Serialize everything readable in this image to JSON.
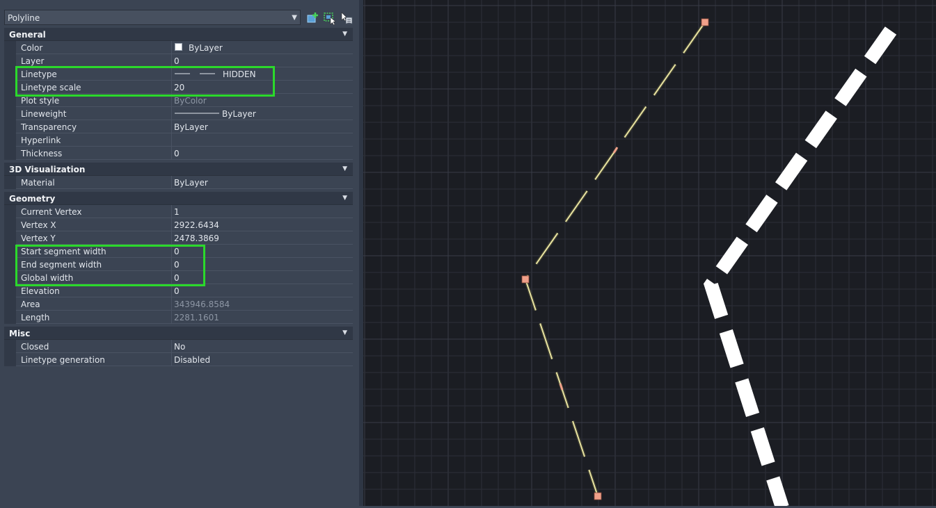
{
  "panel": {
    "object_selector": "Polyline",
    "toolbar_icons": [
      "quick-select-icon",
      "select-objects-icon",
      "toggle-pickadd-icon"
    ]
  },
  "sections": [
    {
      "title": "General",
      "rows": [
        {
          "label": "Color",
          "value": "ByLayer",
          "swatch": "#ffffff"
        },
        {
          "label": "Layer",
          "value": "0"
        },
        {
          "label": "Linetype",
          "value": "HIDDEN",
          "preview": "dashes"
        },
        {
          "label": "Linetype scale",
          "value": "20"
        },
        {
          "label": "Plot style",
          "value": "ByColor",
          "dim": true
        },
        {
          "label": "Lineweight",
          "value": "ByLayer",
          "preview": "solid"
        },
        {
          "label": "Transparency",
          "value": "ByLayer"
        },
        {
          "label": "Hyperlink",
          "value": ""
        },
        {
          "label": "Thickness",
          "value": "0"
        }
      ]
    },
    {
      "title": "3D Visualization",
      "rows": [
        {
          "label": "Material",
          "value": "ByLayer"
        }
      ]
    },
    {
      "title": "Geometry",
      "rows": [
        {
          "label": "Current Vertex",
          "value": "1"
        },
        {
          "label": "Vertex X",
          "value": "2922.6434"
        },
        {
          "label": "Vertex Y",
          "value": "2478.3869"
        },
        {
          "label": "Start segment width",
          "value": "0"
        },
        {
          "label": "End segment width",
          "value": "0"
        },
        {
          "label": "Global width",
          "value": "0"
        },
        {
          "label": "Elevation",
          "value": "0"
        },
        {
          "label": "Area",
          "value": "343946.8584",
          "dim": true
        },
        {
          "label": "Length",
          "value": "2281.1601",
          "dim": true
        }
      ]
    },
    {
      "title": "Misc",
      "rows": [
        {
          "label": "Closed",
          "value": "No"
        },
        {
          "label": "Linetype generation",
          "value": "Disabled"
        }
      ]
    }
  ],
  "colors": {
    "highlight": "#2bd92b",
    "grip": "#f0a08a",
    "polyline": "#e8e3a0",
    "wide_polyline": "#ffffff",
    "grid": "#2c2f38"
  }
}
